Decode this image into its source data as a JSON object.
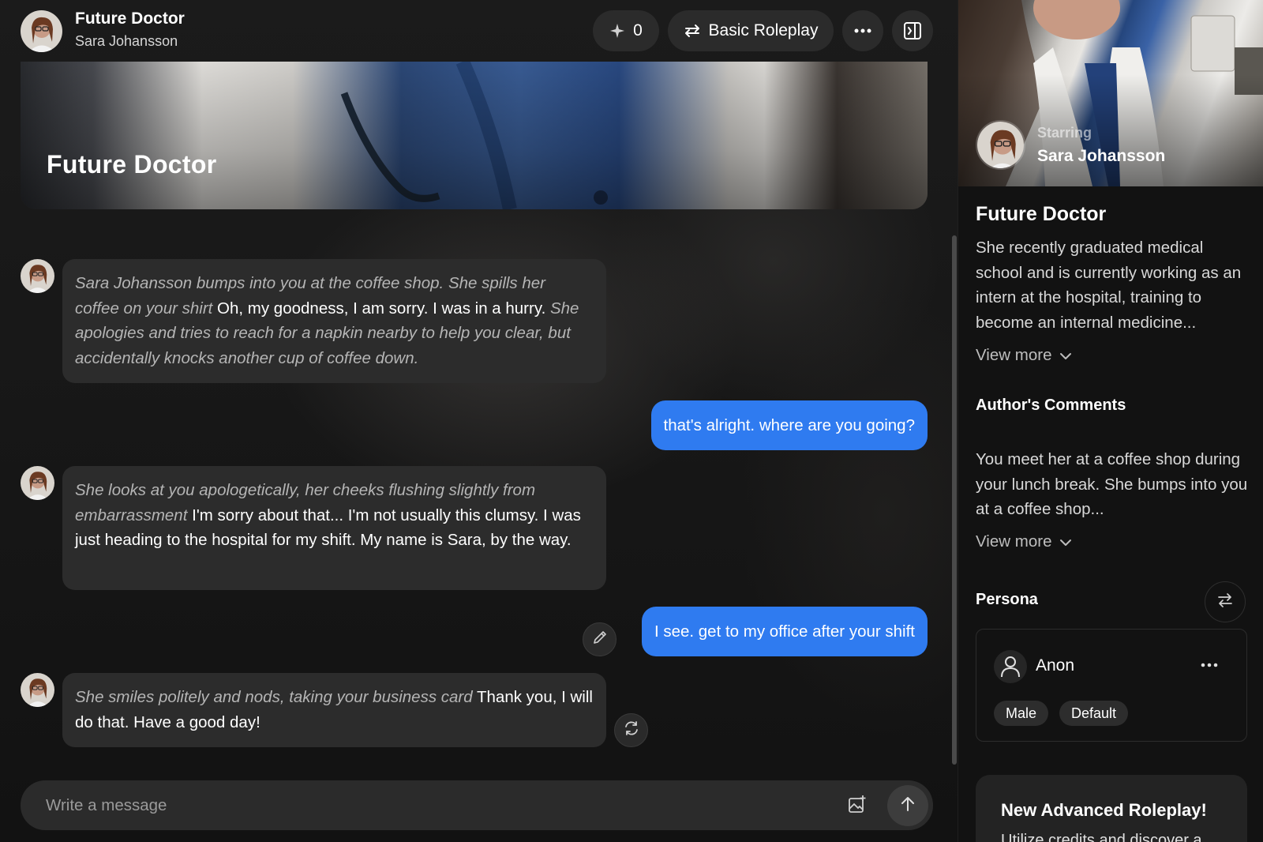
{
  "header": {
    "title": "Future Doctor",
    "subtitle": "Sara Johansson",
    "sparkle_count": "0",
    "mode_label": "Basic Roleplay"
  },
  "banner": {
    "title": "Future Doctor"
  },
  "messages": [
    {
      "role": "character",
      "action": "Sara Johansson bumps into you at the coffee shop. She spills her coffee on your shirt",
      "speech": "Oh, my goodness, I am sorry. I was in a hurry.",
      "action2": "She apologies and tries to reach for a napkin nearby to help you clear, but accidentally knocks another cup of coffee down."
    },
    {
      "role": "user",
      "text": "that's alright. where are you going?"
    },
    {
      "role": "character",
      "action": "She looks at you apologetically, her cheeks flushing slightly from embarrassment",
      "speech": "I'm sorry about that... I'm not usually this clumsy. I was just heading to the hospital for my shift. My name is Sara, by the way."
    },
    {
      "role": "user",
      "text": "I see. get to my office after your shift"
    },
    {
      "role": "character",
      "action": "She smiles politely and nods, taking your business card",
      "speech": "Thank you, I will do that. Have a good day!"
    }
  ],
  "composer": {
    "placeholder": "Write a message"
  },
  "sidebar": {
    "starring_label": "Starring",
    "character_name": "Sara Johansson",
    "title": "Future Doctor",
    "description": "She recently graduated medical school and is currently working as an intern at the hospital, training to become an internal medicine...",
    "view_more": "View more",
    "authors_comments_heading": "Author's Comments",
    "authors_comments": "You meet her at a coffee shop during your lunch break. She bumps into you at a coffee shop...",
    "persona_heading": "Persona",
    "persona": {
      "name": "Anon",
      "tags": [
        "Male",
        "Default"
      ]
    },
    "promo": {
      "title": "New Advanced Roleplay!",
      "text": "Utilize credits and discover a"
    }
  },
  "colors": {
    "user_bubble": "#2f7bf0",
    "bot_bubble": "#2c2c2c",
    "background": "#121212"
  }
}
